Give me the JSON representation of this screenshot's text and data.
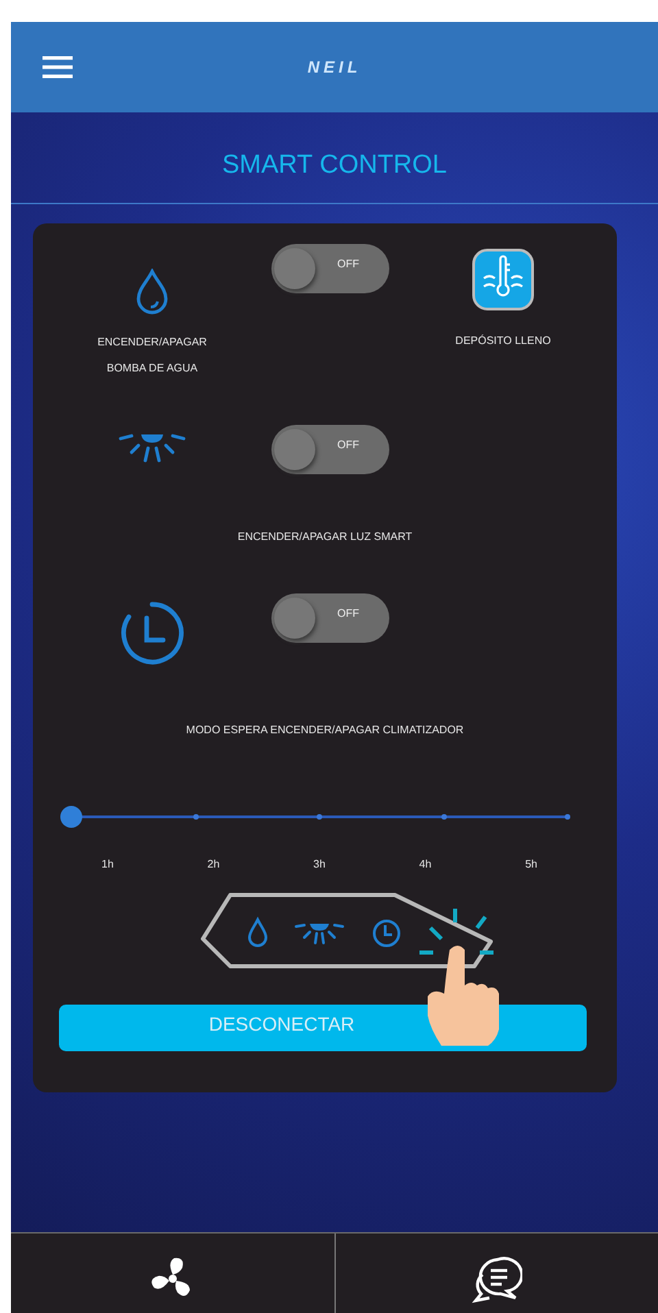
{
  "header": {
    "logo": "NEIL"
  },
  "title": "SMART CONTROL",
  "controls": [
    {
      "kind": "pump",
      "label": "ENCENDER/APAGAR\nBOMBA DE AGUA",
      "toggle_text": "OFF",
      "on": false,
      "status": {
        "label": "DEPÓSITO LLENO",
        "active": true
      }
    },
    {
      "kind": "light",
      "label": "ENCENDER/APAGAR LUZ SMART",
      "toggle_text": "OFF",
      "on": false
    },
    {
      "kind": "timer",
      "label": "MODO ESPERA ENCENDER/APAGAR CLIMATIZADOR",
      "toggle_text": "OFF",
      "on": false
    }
  ],
  "timer_slider": {
    "level": 0,
    "labels": [
      "1h",
      "2h",
      "3h",
      "4h",
      "5h"
    ]
  },
  "disconnect_button": "DESCONECTAR",
  "bottom_nav": [
    {
      "kind": "fan"
    },
    {
      "kind": "chat"
    }
  ]
}
